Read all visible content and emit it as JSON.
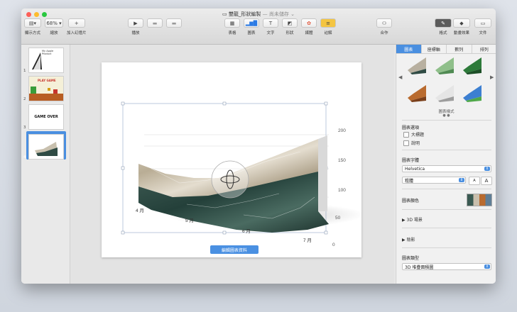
{
  "window": {
    "title": "雙龍_形狀編製",
    "subtitle": "— 尚未儲存 ⌄"
  },
  "toolbar": {
    "view_label": "顯示方式",
    "zoom_value": "68%",
    "zoom_label": "縮放",
    "add_slide_label": "加入幻燈片",
    "play_label": "播放",
    "table_label": "表格",
    "chart_label": "圖表",
    "text_label": "文字",
    "shape_label": "形狀",
    "media_label": "媒體",
    "comment_label": "註解",
    "collab_label": "合作",
    "format_label": "格式",
    "animate_label": "動畫效果",
    "document_label": "文件"
  },
  "slides": [
    {
      "num": "1",
      "caption": "My Apple Product"
    },
    {
      "num": "2",
      "caption": "PLAY GAME"
    },
    {
      "num": "3",
      "caption": "GAME OVER"
    },
    {
      "num": "4",
      "caption": ""
    }
  ],
  "chart_data": {
    "type": "area",
    "categories": [
      "4 月",
      "5 月",
      "6 月",
      "7 月"
    ],
    "y_ticks": [
      "200",
      "150",
      "100",
      "50",
      "0"
    ],
    "ylim": [
      0,
      200
    ],
    "grid": true,
    "style": "3D stacked area, marble textures"
  },
  "edit_chart_data_label": "編輯圖表資料",
  "inspector": {
    "tabs": [
      "圖表",
      "座標軸",
      "數列",
      "排列"
    ],
    "style_caption": "圖表樣式",
    "options_title": "圖表選項",
    "legend_label": "大標題",
    "caption_label": "說明",
    "font_title": "圖表字體",
    "font_value": "Helvetica",
    "weight_value": "粗體",
    "size_small": "A",
    "size_large": "A",
    "color_title": "圖表顏色",
    "scene_label": "3D 場景",
    "shadow_label": "陰影",
    "type_title": "圖表類型",
    "type_value": "3D 堆疊面積圖"
  },
  "colors": {
    "accent": "#4a8fe0",
    "marble_light": "#cfc6b4",
    "marble_dark": "#2f4b44"
  }
}
